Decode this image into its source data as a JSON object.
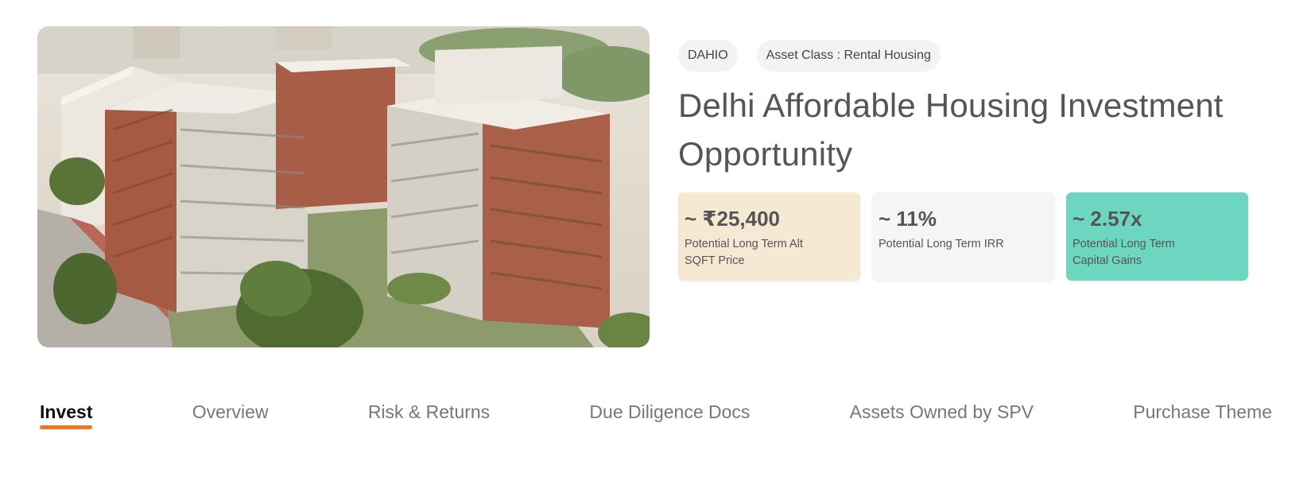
{
  "property": {
    "image_alt": "Aerial rendering of brick and white residential apartment blocks surrounded by trees",
    "tags": [
      "DAHIO",
      "Asset Class : Rental Housing"
    ],
    "title": "Delhi Affordable Housing Investment Opportunity"
  },
  "stats": [
    {
      "value": "~ ₹25,400",
      "label": "Potential Long Term Alt SQFT Price",
      "bg": "#f5e9d4"
    },
    {
      "value": "~ 11%",
      "label": "Potential Long Term IRR",
      "bg": "#f5f5f5"
    },
    {
      "value": "~ 2.57x",
      "label": "Potential Long Term Capital Gains",
      "bg": "#6dd6c1"
    }
  ],
  "tabs": [
    "Invest",
    "Overview",
    "Risk & Returns",
    "Due Diligence Docs",
    "Assets Owned by SPV",
    "Purchase Theme"
  ],
  "active_tab": 0,
  "colors": {
    "accent": "#f07524"
  }
}
